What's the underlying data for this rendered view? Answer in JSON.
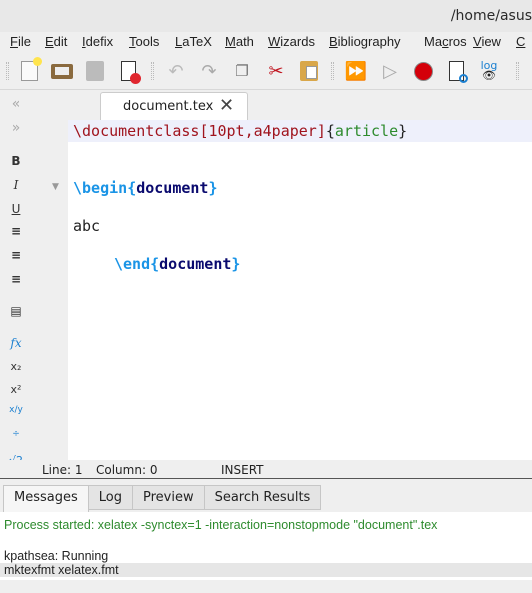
{
  "window": {
    "title": "/home/asus"
  },
  "menu": [
    {
      "label": "File",
      "ul": "F",
      "rest": "ile"
    },
    {
      "label": "Edit",
      "ul": "E",
      "rest": "dit"
    },
    {
      "label": "Idefix",
      "ul": "I",
      "rest": "defix"
    },
    {
      "label": "Tools",
      "ul": "T",
      "rest": "ools"
    },
    {
      "label": "LaTeX",
      "ul": "L",
      "rest": "aTeX"
    },
    {
      "label": "Math",
      "ul": "M",
      "rest": "ath"
    },
    {
      "label": "Wizards",
      "ul": "W",
      "rest": "izards"
    },
    {
      "label": "Bibliography",
      "ul": "B",
      "rest": "ibliography"
    },
    {
      "label": "Macros",
      "pre": "Ma",
      "ul": "c",
      "rest": "ros"
    },
    {
      "label": "View",
      "ul": "V",
      "rest": "iew"
    },
    {
      "label": "C",
      "ul": "C",
      "rest": ""
    }
  ],
  "toolbar": {
    "icons": [
      "new-file",
      "open-folder",
      "save",
      "close-file",
      "undo",
      "redo",
      "copy",
      "cut",
      "paste",
      "quick-build",
      "compile",
      "stop",
      "view-pdf",
      "view-log"
    ],
    "log_label": "log"
  },
  "tab": {
    "label": "document.tex"
  },
  "editor": {
    "lines": [
      {
        "cmd": "\\documentclass",
        "opt": "[10pt,a4paper]",
        "open": "{",
        "arg": "article",
        "close": "}"
      },
      {
        "cmd": "\\begin",
        "open": "{",
        "arg": "document",
        "close": "}"
      },
      {
        "text": "abc"
      },
      {
        "cmd": "\\end",
        "open": "{",
        "arg": "document",
        "close": "}"
      }
    ]
  },
  "leftpanel": {
    "bold": "B",
    "italic": "I",
    "underline": "U"
  },
  "status": {
    "line": "Line: 1",
    "column": "Column: 0",
    "mode": "INSERT"
  },
  "bottom_tabs": [
    "Messages",
    "Log",
    "Preview",
    "Search Results"
  ],
  "messages": {
    "process": "Process started: xelatex -synctex=1 -interaction=nonstopmode \"document\".tex",
    "l1": "kpathsea: Running",
    "l2": "mktexfmt xelatex.fmt"
  },
  "colors": {
    "process_text": "#2e8b2e",
    "command": "#a0141e",
    "env": "#1a94e6"
  }
}
